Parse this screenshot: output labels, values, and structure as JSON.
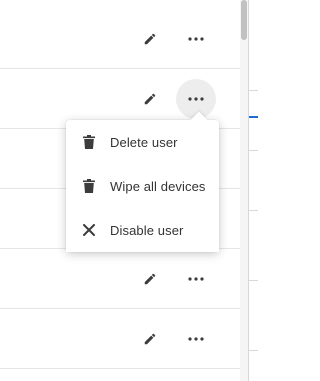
{
  "rows": [
    {
      "actions": [
        "edit-icon",
        "more-icon"
      ]
    },
    {
      "actions": [
        "edit-icon",
        "more-icon"
      ],
      "menu_open": true
    },
    {
      "actions": []
    },
    {
      "actions": []
    },
    {
      "actions": [
        "edit-icon",
        "more-icon"
      ]
    },
    {
      "actions": [
        "edit-icon",
        "more-icon"
      ]
    }
  ],
  "menu": {
    "items": [
      {
        "icon": "trash-icon",
        "label": "Delete user"
      },
      {
        "icon": "trash-icon",
        "label": "Wipe all devices"
      },
      {
        "icon": "close-icon",
        "label": "Disable user"
      }
    ]
  },
  "colors": {
    "icon": "#3c3c3c",
    "divider": "#e6e6e6",
    "accent": "#1e6bd6"
  }
}
